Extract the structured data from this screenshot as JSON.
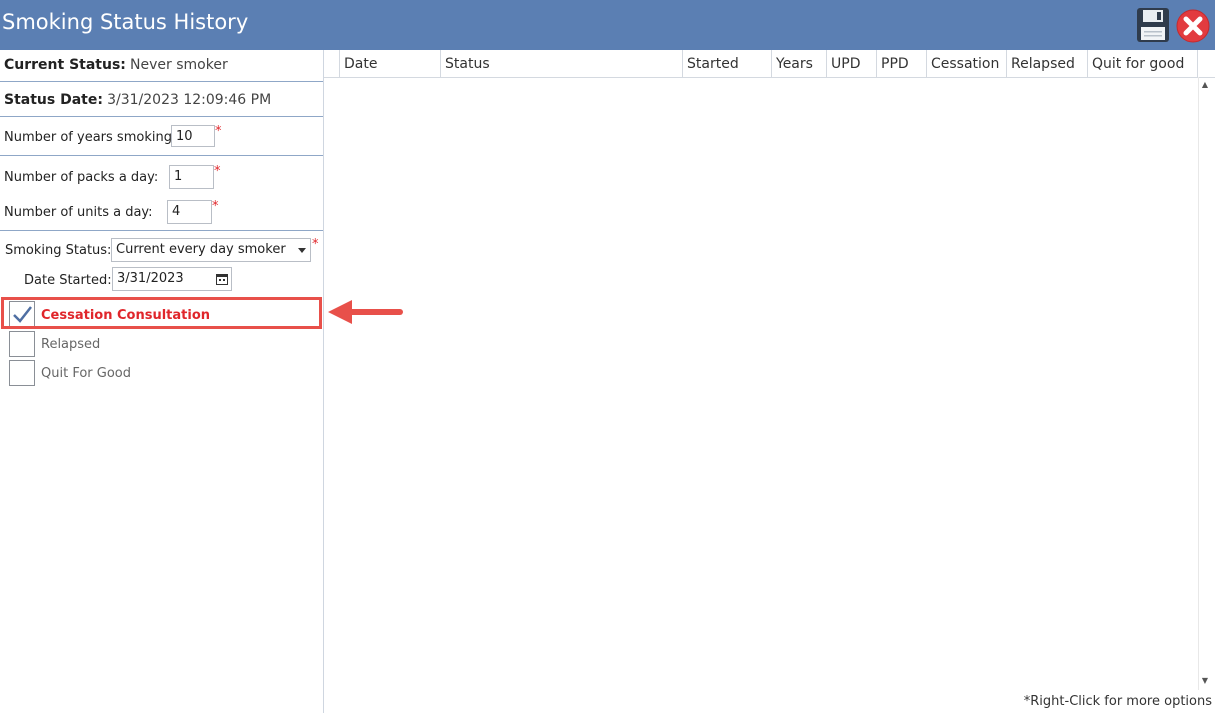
{
  "window": {
    "title": "Smoking Status History"
  },
  "toolbar": {
    "save_icon": "save-icon",
    "close_icon": "close-icon"
  },
  "current_status": {
    "label": "Current Status:",
    "value": "Never smoker"
  },
  "status_date": {
    "label": "Status Date:",
    "value": "3/31/2023 12:09:46 PM"
  },
  "years_smoking": {
    "label": "Number of years smoking:",
    "value": "10"
  },
  "packs_per_day": {
    "label": "Number of packs a day:",
    "value": "1"
  },
  "units_per_day": {
    "label": "Number of units a day:",
    "value": "4"
  },
  "required_marker": "*",
  "smoking_status": {
    "label": "Smoking Status:",
    "value": "Current every day smoker"
  },
  "date_started": {
    "label": "Date Started:",
    "value": "3/31/2023"
  },
  "checkboxes": [
    {
      "label": "Cessation Consultation",
      "checked": true
    },
    {
      "label": "Relapsed",
      "checked": false
    },
    {
      "label": "Quit For Good",
      "checked": false
    }
  ],
  "grid": {
    "columns": [
      "Date",
      "Status",
      "Started",
      "Years",
      "UPD",
      "PPD",
      "Cessation",
      "Relapsed",
      "Quit for good"
    ]
  },
  "footer": {
    "note": "*Right-Click for more options"
  },
  "colors": {
    "titlebar": "#5b7fb3",
    "highlight": "#e8504a",
    "required": "#e0262b"
  }
}
